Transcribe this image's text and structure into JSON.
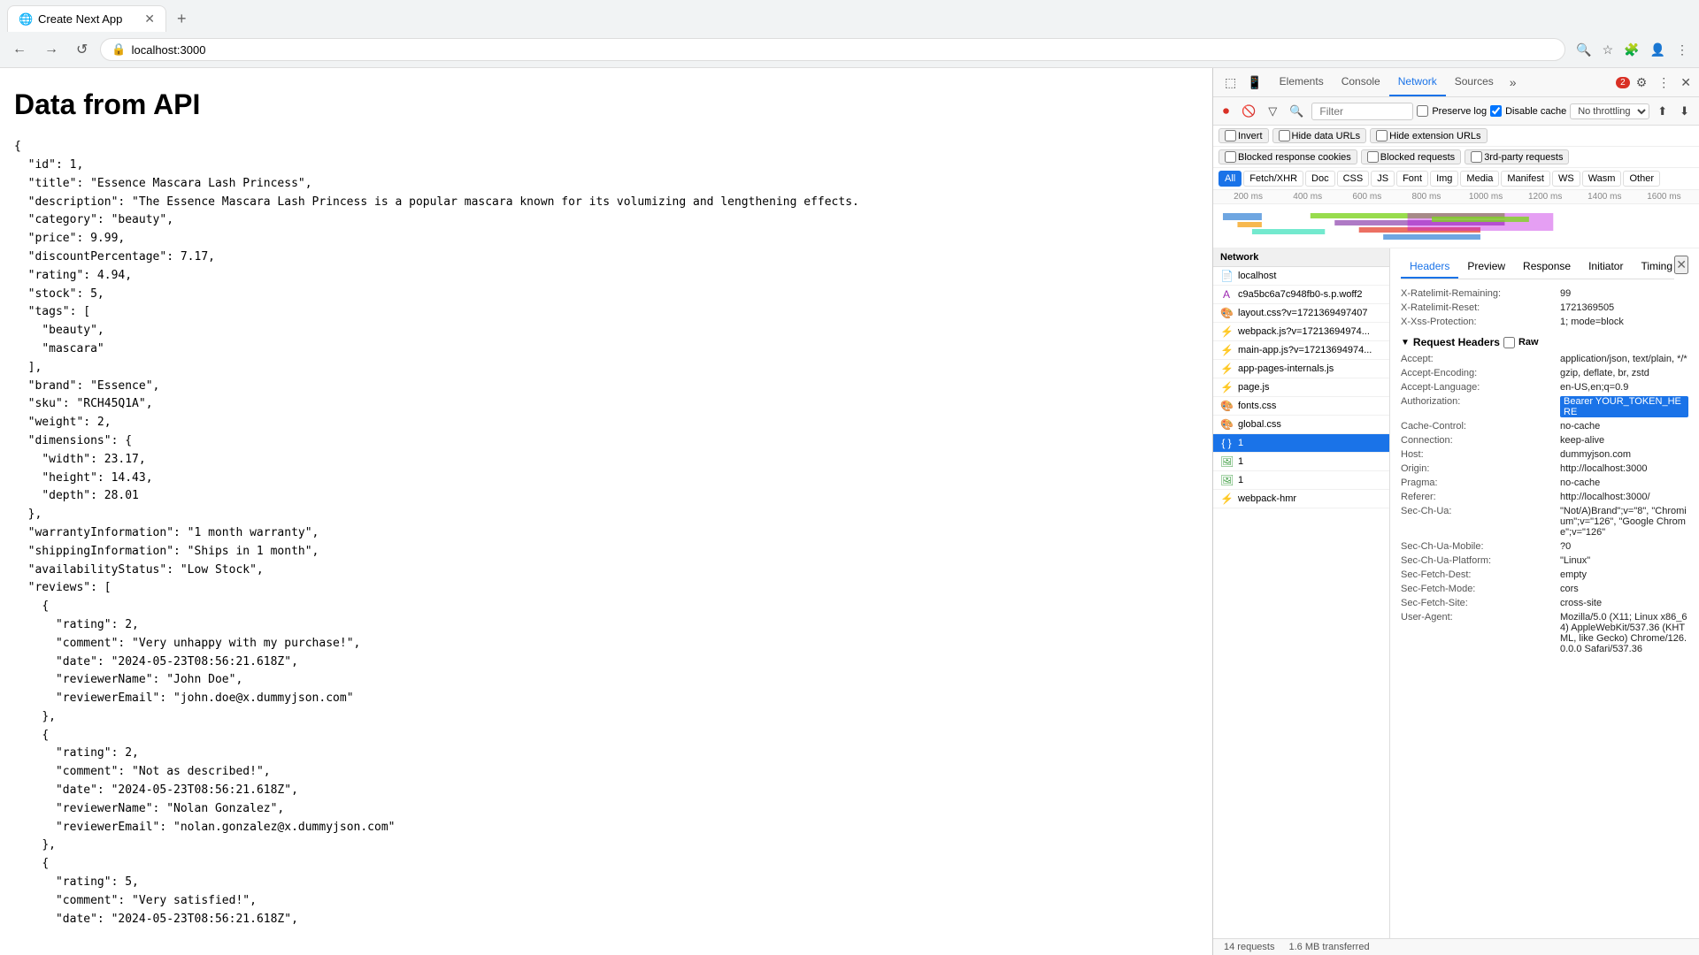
{
  "browser": {
    "tab_title": "Create Next App",
    "tab_favicon": "●",
    "address": "localhost:3000",
    "new_tab_label": "+",
    "nav_back": "←",
    "nav_forward": "→",
    "nav_refresh": "↺"
  },
  "page": {
    "title": "Data from API",
    "json_content": "{\n  \"id\": 1,\n  \"title\": \"Essence Mascara Lash Princess\",\n  \"description\": \"The Essence Mascara Lash Princess is a popular mascara known for its volumizing and lengthening effects.\n  \"category\": \"beauty\",\n  \"price\": 9.99,\n  \"discountPercentage\": 7.17,\n  \"rating\": 4.94,\n  \"stock\": 5,\n  \"tags\": [\n    \"beauty\",\n    \"mascara\"\n  ],\n  \"brand\": \"Essence\",\n  \"sku\": \"RCH45Q1A\",\n  \"weight\": 2,\n  \"dimensions\": {\n    \"width\": 23.17,\n    \"height\": 14.43,\n    \"depth\": 28.01\n  },\n  \"warrantyInformation\": \"1 month warranty\",\n  \"shippingInformation\": \"Ships in 1 month\",\n  \"availabilityStatus\": \"Low Stock\",\n  \"reviews\": [\n    {\n      \"rating\": 2,\n      \"comment\": \"Very unhappy with my purchase!\",\n      \"date\": \"2024-05-23T08:56:21.618Z\",\n      \"reviewerName\": \"John Doe\",\n      \"reviewerEmail\": \"john.doe@x.dummyjson.com\"\n    },\n    {\n      \"rating\": 2,\n      \"comment\": \"Not as described!\",\n      \"date\": \"2024-05-23T08:56:21.618Z\",\n      \"reviewerName\": \"Nolan Gonzalez\",\n      \"reviewerEmail\": \"nolan.gonzalez@x.dummyjson.com\"\n    },\n    {\n      \"rating\": 5,\n      \"comment\": \"Very satisfied!\",\n      \"date\": \"2024-05-23T08:56:21.618Z\","
  },
  "devtools": {
    "tabs": [
      "Elements",
      "Console",
      "Network",
      "Sources",
      "More"
    ],
    "active_tab": "Network",
    "error_badge": "2",
    "toolbar": {
      "record_title": "Stop recording network log",
      "clear_title": "Clear",
      "filter_title": "Filter",
      "search_title": "Search",
      "preserve_log": "Preserve log",
      "disable_cache": "Disable cache",
      "throttle": "No throttling",
      "import": "Import",
      "export": "Export"
    },
    "filter_options": {
      "invert": "Invert",
      "hide_data_urls": "Hide data URLs",
      "hide_extension_urls": "Hide extension URLs",
      "blocked_cookies": "Blocked response cookies",
      "blocked_requests": "Blocked requests",
      "third_party": "3rd-party requests"
    },
    "type_filters": [
      "All",
      "Fetch/XHR",
      "Doc",
      "CSS",
      "JS",
      "Font",
      "Img",
      "Media",
      "Manifest",
      "WS",
      "Wasm",
      "Other"
    ],
    "active_type_filter": "All",
    "timeline_labels": [
      "200 ms",
      "400 ms",
      "600 ms",
      "800 ms",
      "1000 ms",
      "1200 ms",
      "1400 ms",
      "1600 ms"
    ]
  },
  "requests": [
    {
      "id": "req-localhost",
      "name": "localhost",
      "icon": "doc",
      "type": "doc"
    },
    {
      "id": "req-c9a5bc6a",
      "name": "c9a5bc6a7c948fb0-s.p.woff2",
      "icon": "font",
      "type": "font"
    },
    {
      "id": "req-layout-css",
      "name": "layout.css?v=1721369497407",
      "icon": "css",
      "type": "css"
    },
    {
      "id": "req-webpack-js",
      "name": "webpack.js?v=17213694974...",
      "icon": "js",
      "type": "js"
    },
    {
      "id": "req-main-app-js",
      "name": "main-app.js?v=17213694974...",
      "icon": "js",
      "type": "js"
    },
    {
      "id": "req-app-pages",
      "name": "app-pages-internals.js",
      "icon": "js",
      "type": "js"
    },
    {
      "id": "req-page-js",
      "name": "page.js",
      "icon": "js",
      "type": "js"
    },
    {
      "id": "req-fonts-css",
      "name": "fonts.css",
      "icon": "css",
      "type": "css"
    },
    {
      "id": "req-global-css",
      "name": "global.css",
      "icon": "css",
      "type": "css"
    },
    {
      "id": "req-1-active",
      "name": "1",
      "icon": "xhr",
      "type": "xhr",
      "active": true
    },
    {
      "id": "req-1-img1",
      "name": "1",
      "icon": "img",
      "type": "img"
    },
    {
      "id": "req-1-img2",
      "name": "1",
      "icon": "img",
      "type": "img"
    },
    {
      "id": "req-webpack-hmr",
      "name": "webpack-hmr",
      "icon": "ws",
      "type": "ws"
    }
  ],
  "detail": {
    "tabs": [
      "Headers",
      "Preview",
      "Response",
      "Initiator",
      "Timing"
    ],
    "active_tab": "Headers",
    "response_headers": [
      {
        "key": "X-Ratelimit-Remaining:",
        "value": "99"
      },
      {
        "key": "X-Ratelimit-Reset:",
        "value": "1721369505"
      },
      {
        "key": "X-Xss-Protection:",
        "value": "1; mode=block"
      }
    ],
    "request_headers_section": "Request Headers",
    "raw_label": "Raw",
    "request_headers": [
      {
        "key": "Accept:",
        "value": "application/json, text/plain, */*"
      },
      {
        "key": "Accept-Encoding:",
        "value": "gzip, deflate, br, zstd"
      },
      {
        "key": "Accept-Language:",
        "value": "en-US,en;q=0.9"
      },
      {
        "key": "Authorization:",
        "value": "Bearer YOUR_TOKEN_HERE",
        "highlight": true
      },
      {
        "key": "Cache-Control:",
        "value": "no-cache"
      },
      {
        "key": "Connection:",
        "value": "keep-alive"
      },
      {
        "key": "Host:",
        "value": "dummyjson.com"
      },
      {
        "key": "Origin:",
        "value": "http://localhost:3000"
      },
      {
        "key": "Pragma:",
        "value": "no-cache"
      },
      {
        "key": "Referer:",
        "value": "http://localhost:3000/"
      },
      {
        "key": "Sec-Ch-Ua:",
        "value": "\"Not/A)Brand\";v=\"8\", \"Chromium\";v=\"126\", \"Google Chrome\";v=\"126\""
      },
      {
        "key": "Sec-Ch-Ua-Mobile:",
        "value": "?0"
      },
      {
        "key": "Sec-Ch-Ua-Platform:",
        "value": "\"Linux\""
      },
      {
        "key": "Sec-Fetch-Dest:",
        "value": "empty"
      },
      {
        "key": "Sec-Fetch-Mode:",
        "value": "cors"
      },
      {
        "key": "Sec-Fetch-Site:",
        "value": "cross-site"
      },
      {
        "key": "User-Agent:",
        "value": "Mozilla/5.0 (X11; Linux x86_64) AppleWebKit/537.36 (KHTML, like Gecko) Chrome/126.0.0.0 Safari/537.36"
      }
    ]
  },
  "status_bar": {
    "requests": "14 requests",
    "transferred": "1.6 MB transferred"
  }
}
